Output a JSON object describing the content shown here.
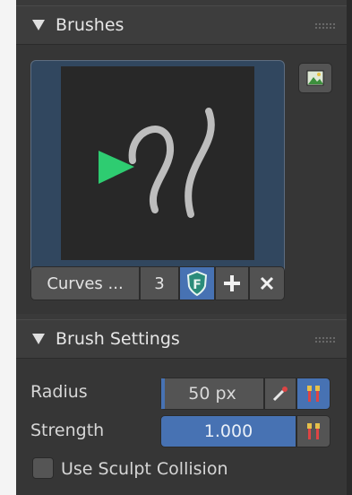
{
  "brushes_panel": {
    "title": "Brushes",
    "brush_name": "Curves ...",
    "user_count": "3"
  },
  "brush_settings_panel": {
    "title": "Brush Settings",
    "radius_label": "Radius",
    "radius_value": "50 px",
    "strength_label": "Strength",
    "strength_value": "1.000",
    "strength_fraction": 1.0,
    "collision_label": "Use Sculpt Collision",
    "collision_checked": false
  },
  "colors": {
    "accent_blue": "#4772b3",
    "preview_bg": "#31475f",
    "shield_green": "#2a8c7a",
    "triangle_green": "#2ecc71"
  },
  "icons": [
    "panel-expand-triangle",
    "drag-grip",
    "image-browse",
    "fake-user-shield",
    "add-plus",
    "unlink-x",
    "pressure-brush",
    "driver-pin"
  ]
}
